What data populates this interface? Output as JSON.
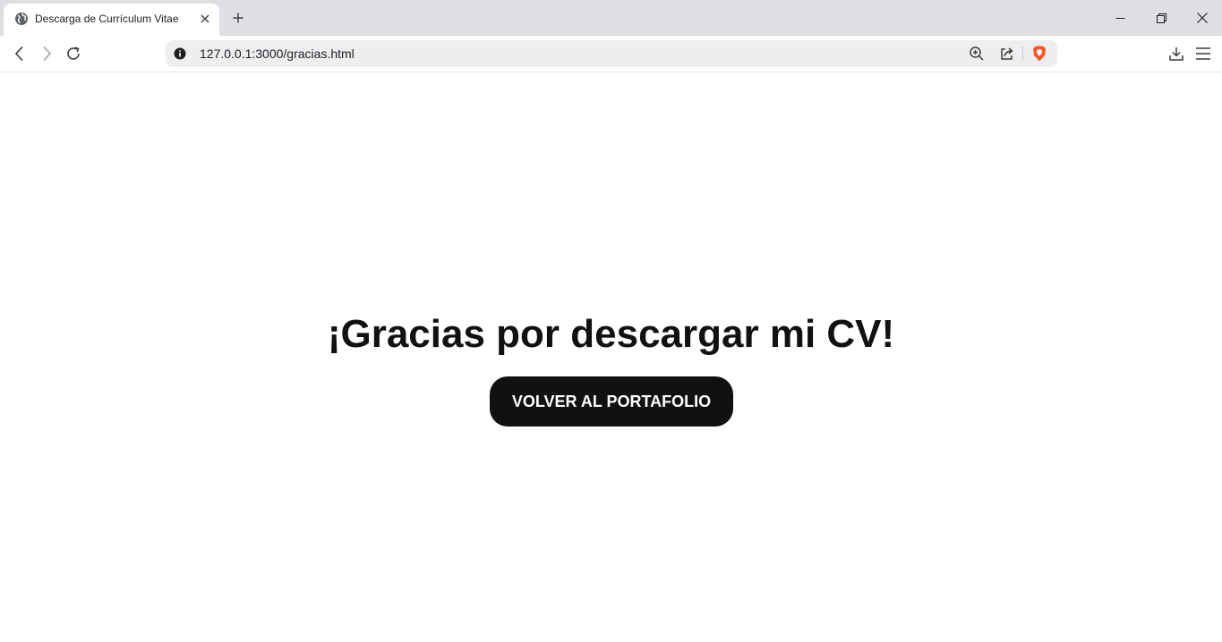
{
  "browser": {
    "tab": {
      "title": "Descarga de Currículum Vitae",
      "favicon": "globe-icon"
    },
    "new_tab_icon": "plus-icon",
    "window_controls": [
      "minimize-icon",
      "restore-icon",
      "close-icon"
    ],
    "address_bar": {
      "url": "127.0.0.1:3000/gracias.html",
      "info_icon": "info-icon"
    },
    "toolbar_icons": [
      "back-icon",
      "forward-icon",
      "reload-icon",
      "zoom-icon",
      "share-icon",
      "brave-shield-icon",
      "download-icon",
      "menu-icon"
    ],
    "brave_color": "#fb542b"
  },
  "page": {
    "heading": "¡Gracias por descargar mi CV!",
    "button_label": "VOLVER AL PORTAFOLIO",
    "button_color": "#111111",
    "text_color": "#111111"
  }
}
